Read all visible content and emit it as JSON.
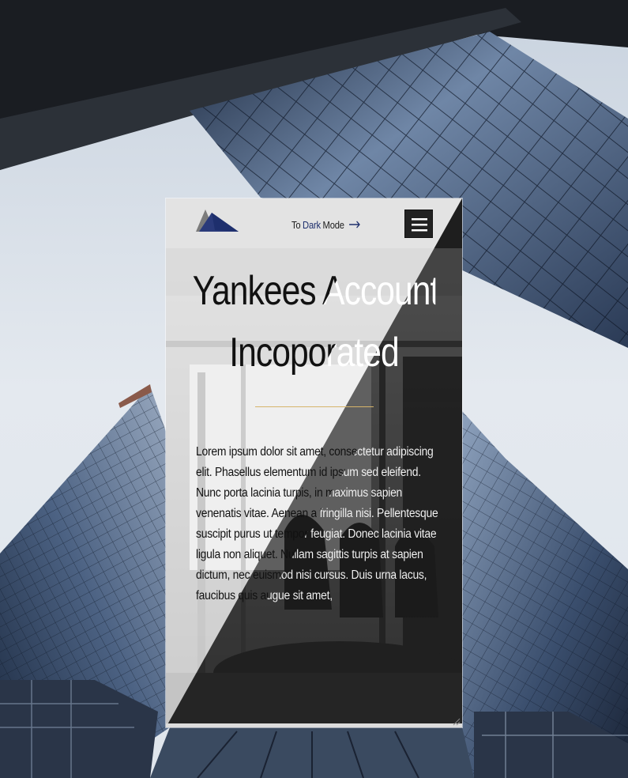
{
  "header": {
    "mode_prefix": "To",
    "mode_accent": "Dark",
    "mode_suffix": "Mode",
    "arrow_icon": "arrow-right-icon",
    "menu_icon": "hamburger-icon",
    "logo_icon": "mountain-logo-icon"
  },
  "hero": {
    "title_line1": "Yankees Accounting",
    "title_line2": "Incoporated"
  },
  "content": {
    "paragraph": "Lorem ipsum dolor sit amet, consectetur adipiscing elit. Phasellus elementum id ipsum sed eleifend. Nunc porta lacinia turpis, in maximus sapien venenatis vitae. Aenean a fringilla nisi. Pellentesque suscipit purus ut tempor feugiat. Donec lacinia vitae ligula non aliquet. Nullam sagittis turpis at sapien dictum, nec euismod nisi cursus. Duis urna lacus, faucibus quis augue sit amet,"
  },
  "colors": {
    "accent_blue": "#1e2f6d",
    "divider_gold": "#d6b46a",
    "light_panel": "#e4e4e4",
    "dark_panel": "#1a1a1a"
  }
}
